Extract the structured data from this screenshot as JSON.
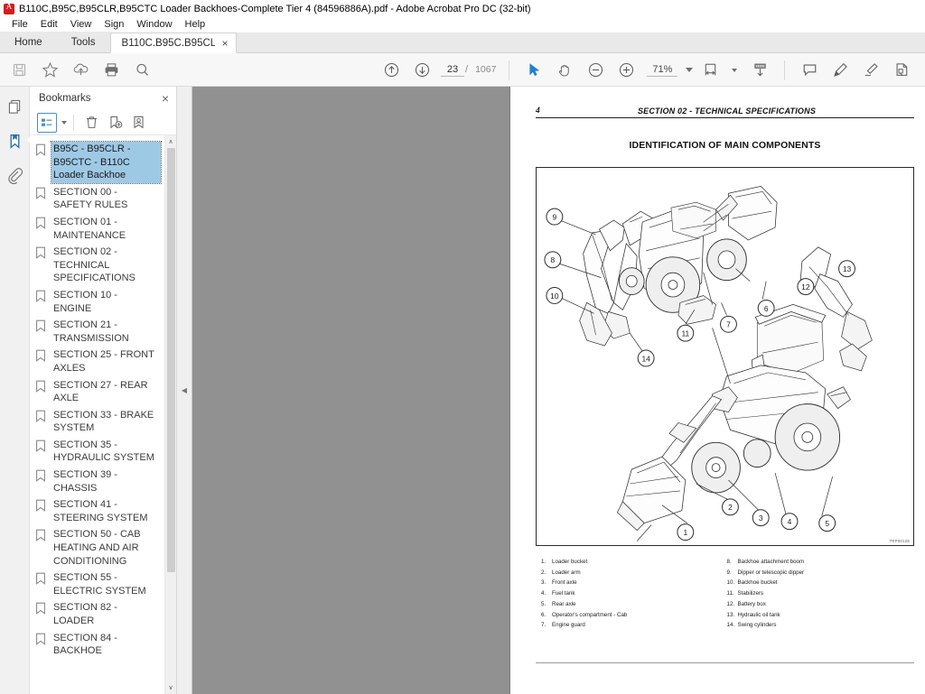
{
  "window": {
    "title": "B110C,B95C,B95CLR,B95CTC Loader Backhoes-Complete Tier 4 (84596886A).pdf - Adobe Acrobat Pro DC (32-bit)",
    "app_icon": "acrobat-logo-icon"
  },
  "menu": {
    "items": [
      "File",
      "Edit",
      "View",
      "Sign",
      "Window",
      "Help"
    ]
  },
  "tabs": {
    "home": "Home",
    "tools": "Tools",
    "document": "B110C.B95C.B95CL...",
    "close_glyph": "×"
  },
  "toolbar": {
    "save_label": "save-icon",
    "star_label": "add-to-favorites-icon",
    "cloud_label": "upload-to-cloud-icon",
    "print_label": "print-icon",
    "find_label": "find-icon",
    "prev_page": "previous-page-icon",
    "next_page": "next-page-icon",
    "current_page": "23",
    "page_separator": "/",
    "total_pages": "1067",
    "select_tool": "select-cursor-icon",
    "hand_tool": "hand-tool-icon",
    "zoom_out": "zoom-out-icon",
    "zoom_in": "zoom-in-icon",
    "zoom_value": "71%",
    "fit_width": "fit-page-width-icon",
    "scroll_mode": "scrolling-mode-icon",
    "comment": "add-comment-icon",
    "highlight": "highlight-text-icon",
    "sign": "sign-document-icon",
    "stamp": "stamp-icon"
  },
  "rail": {
    "thumbnails": "page-thumbnails-icon",
    "bookmarks": "bookmarks-icon",
    "attachments": "attachments-icon"
  },
  "bookmarks_panel": {
    "title": "Bookmarks",
    "close_glyph": "×",
    "toolbar": {
      "options": "bookmark-options-icon",
      "delete": "delete-bookmark-icon",
      "new": "new-bookmark-icon",
      "edit": "edit-bookmark-icon"
    },
    "items": [
      {
        "label": "B95C - B95CLR - B95CTC - B110C Loader Backhoe",
        "selected": true
      },
      {
        "label": "SECTION 00 - SAFETY RULES",
        "selected": false
      },
      {
        "label": "SECTION 01 - MAINTENANCE",
        "selected": false
      },
      {
        "label": "SECTION 02 - TECHNICAL SPECIFICATIONS",
        "selected": false
      },
      {
        "label": "SECTION 10 - ENGINE",
        "selected": false
      },
      {
        "label": "SECTION 21 - TRANSMISSION",
        "selected": false
      },
      {
        "label": "SECTION 25 - FRONT AXLES",
        "selected": false
      },
      {
        "label": "SECTION 27 - REAR AXLE",
        "selected": false
      },
      {
        "label": "SECTION 33 - BRAKE SYSTEM",
        "selected": false
      },
      {
        "label": "SECTION 35 - HYDRAULIC SYSTEM",
        "selected": false
      },
      {
        "label": "SECTION 39 - CHASSIS",
        "selected": false
      },
      {
        "label": "SECTION 41 - STEERING SYSTEM",
        "selected": false
      },
      {
        "label": "SECTION 50 - CAB HEATING AND AIR CONDITIONING",
        "selected": false
      },
      {
        "label": "SECTION 55 - ELECTRIC SYSTEM",
        "selected": false
      },
      {
        "label": "SECTION 82 - LOADER",
        "selected": false
      },
      {
        "label": "SECTION 84 - BACKHOE",
        "selected": false
      }
    ],
    "scroll_up_glyph": "∧",
    "scroll_down_glyph": "∨"
  },
  "divider": {
    "collapse_glyph": "◀"
  },
  "document": {
    "page_number": "4",
    "section_header": "SECTION 02 - TECHNICAL SPECIFICATIONS",
    "heading": "IDENTIFICATION OF MAIN COMPONENTS",
    "figure_code": "TRP00128",
    "legend_left": [
      {
        "n": "1.",
        "text": "Loader bucket"
      },
      {
        "n": "2.",
        "text": "Loader arm"
      },
      {
        "n": "3.",
        "text": "Front axle"
      },
      {
        "n": "4.",
        "text": "Fuel tank"
      },
      {
        "n": "5.",
        "text": "Rear axle"
      },
      {
        "n": "6.",
        "text": "Operator's compartment - Cab"
      },
      {
        "n": "7.",
        "text": "Engine guard"
      }
    ],
    "legend_right": [
      {
        "n": "8.",
        "text": "Backhoe attachment boom"
      },
      {
        "n": "9.",
        "text": "Dipper or telescopic dipper"
      },
      {
        "n": "10.",
        "text": "Backhoe bucket"
      },
      {
        "n": "11.",
        "text": "Stabilizers"
      },
      {
        "n": "12.",
        "text": "Battery box"
      },
      {
        "n": "13.",
        "text": "Hydraulic oil tank"
      },
      {
        "n": "14.",
        "text": "Swing cylinders"
      }
    ],
    "callouts": [
      "1",
      "2",
      "3",
      "4",
      "5",
      "6",
      "7",
      "8",
      "9",
      "10",
      "11",
      "12",
      "13",
      "14"
    ]
  },
  "colors": {
    "accent": "#4a90c4",
    "selection": "#9ec9e5",
    "canvas": "#919191",
    "chrome": "#f7f7f7",
    "brand_red": "#d61c1c"
  }
}
